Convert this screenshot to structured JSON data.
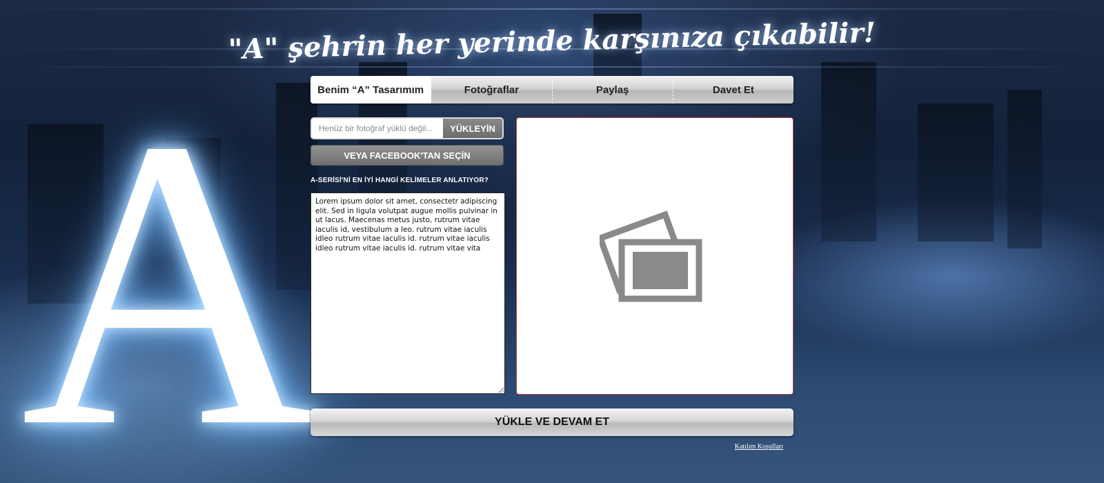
{
  "headline": "\"A\" şehrin her yerinde karşınıza çıkabilir!",
  "logo_letter": "A",
  "tabs": [
    {
      "label": "Benim “A”  Tasarımım",
      "active": true
    },
    {
      "label": "Fotoğraflar",
      "active": false
    },
    {
      "label": "Paylaş",
      "active": false
    },
    {
      "label": "Davet Et",
      "active": false
    }
  ],
  "upload": {
    "placeholder": "Henüz bir fotoğraf yüklü değil...",
    "button_label": "YÜKLEYİN"
  },
  "facebook_button_label": "VEYA FACEBOOK'TAN SEÇİN",
  "question": "A-SERİSİ'Nİ EN İYİ HANGİ KELİMELER ANLATIYOR?",
  "description_text": "Lorem ipsum dolor sit amet, consectetr adipiscing elit. Sed in ligula volutpat augue mollis pulvinar in ut lacus. Maecenas metus justo, rutrum vitae iaculis id, vestibulum a leo. rutrum vitae iaculis idleo rutrum vitae iaculis id. rutrum vitae iaculis idleo rutrum vitae iaculis id. rutrum vitae vita",
  "preview_icon": "photos-placeholder-icon",
  "continue_button_label": "YÜKLE VE DEVAM ET",
  "terms_link": "Katılım Koşulları",
  "colors": {
    "preview_border": "#c23a3a",
    "button_dark": "#6d6d6d"
  }
}
